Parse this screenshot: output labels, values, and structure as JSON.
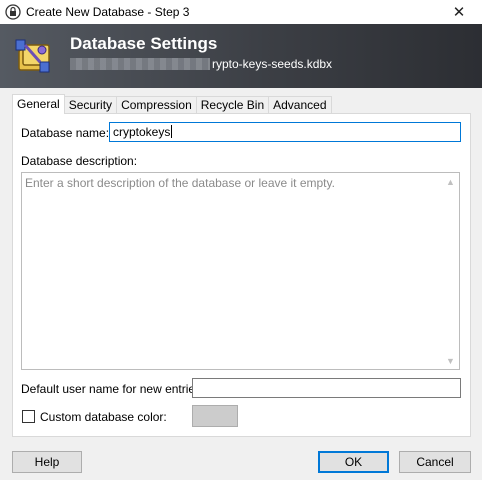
{
  "window": {
    "title": "Create New Database - Step 3",
    "close_glyph": "✕"
  },
  "banner": {
    "heading": "Database Settings",
    "file_suffix": "rypto-keys-seeds.kdbx"
  },
  "tabs": [
    "General",
    "Security",
    "Compression",
    "Recycle Bin",
    "Advanced"
  ],
  "active_tab": "General",
  "general": {
    "name_label": "Database name:",
    "name_value": "cryptokeys",
    "description_label": "Database description:",
    "description_placeholder": "Enter a short description of the database or leave it empty.",
    "default_user_label": "Default user name for new entries:",
    "default_user_value": "",
    "custom_color_label": "Custom database color:",
    "custom_color_checked": false,
    "custom_color_swatch": "#cccccc"
  },
  "buttons": {
    "help": "Help",
    "ok": "OK",
    "cancel": "Cancel"
  },
  "colors": {
    "accent": "#0078d7",
    "banner_dark": "#2c2e33"
  }
}
